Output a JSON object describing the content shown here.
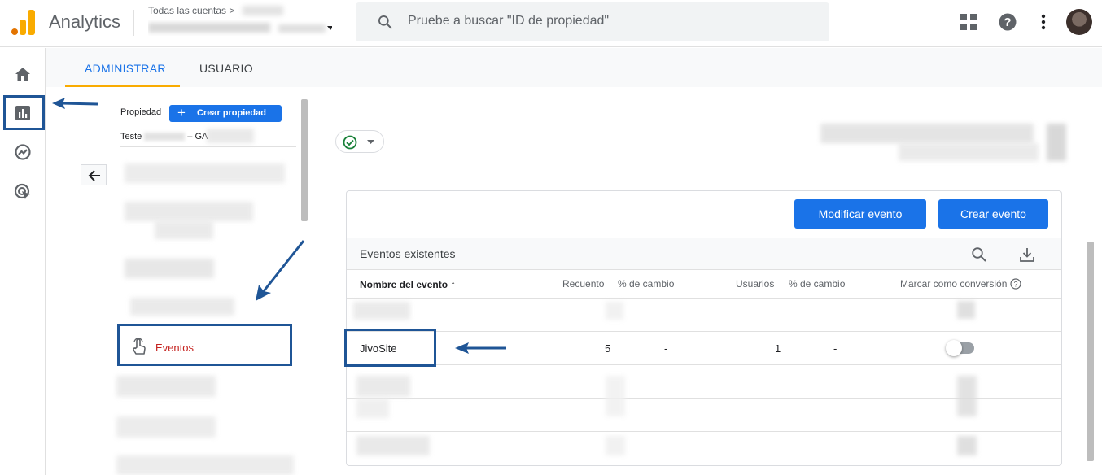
{
  "header": {
    "app_title": "Analytics",
    "account_label": "Todas las cuentas",
    "search_placeholder": "Pruebe a buscar \"ID de propiedad\""
  },
  "tabs": [
    {
      "label": "ADMINISTRAR",
      "active": true
    },
    {
      "label": "USUARIO",
      "active": false
    }
  ],
  "property": {
    "label": "Propiedad",
    "create_button": "Crear propiedad",
    "name_prefix": "Teste",
    "name_suffix": "– GA"
  },
  "nav": {
    "events_label": "Eventos"
  },
  "events_panel": {
    "modify_button": "Modificar evento",
    "create_button": "Crear evento",
    "section_title": "Eventos existentes",
    "columns": [
      "Nombre del evento",
      "Recuento",
      "% de cambio",
      "Usuarios",
      "% de cambio",
      "Marcar como conversión"
    ],
    "rows": [
      {
        "name": "JivoSite",
        "count": "5",
        "count_change": "-",
        "users": "1",
        "users_change": "-",
        "conversion": false
      }
    ]
  },
  "colors": {
    "accent": "#1a73e8",
    "highlight_box": "#1f5596",
    "tab_underline": "#f9ab00",
    "events_label": "#c5221f"
  }
}
